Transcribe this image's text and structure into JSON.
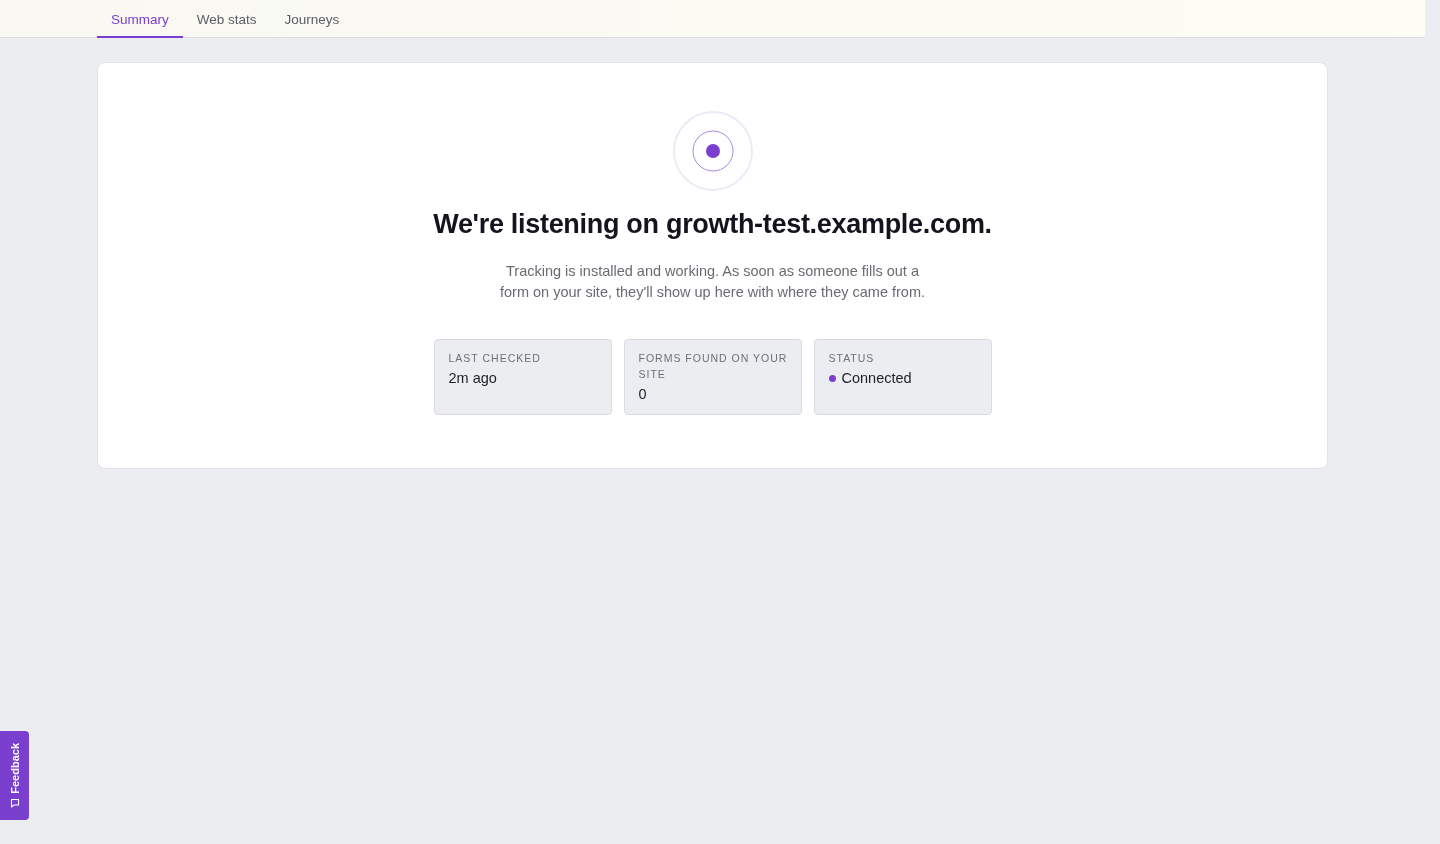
{
  "tabs": [
    {
      "label": "Summary",
      "selected": true
    },
    {
      "label": "Web stats",
      "selected": false
    },
    {
      "label": "Journeys",
      "selected": false
    }
  ],
  "hero": {
    "heading": "We're listening on growth-test.example.com.",
    "description": "Tracking is installed and working. As soon as someone fills out a form on your site, they'll show up here with where they came from."
  },
  "stats": [
    {
      "kind": "text",
      "label": "LAST CHECKED",
      "value": "2m ago"
    },
    {
      "kind": "text",
      "label": "FORMS FOUND ON YOUR SITE",
      "value": "0"
    },
    {
      "kind": "status",
      "label": "STATUS",
      "value": "Connected",
      "color": "#7b3fd0"
    }
  ],
  "feedback": {
    "label": "Feedback"
  }
}
